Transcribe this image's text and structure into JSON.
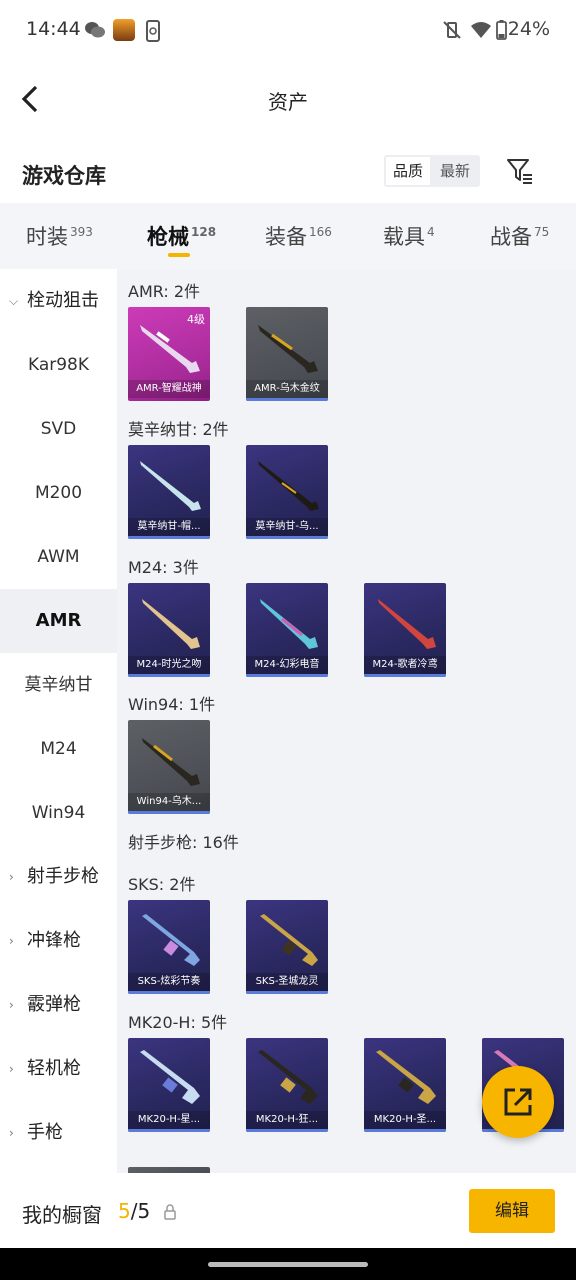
{
  "status_bar": {
    "time": "14:44",
    "battery": "24%"
  },
  "header": {
    "title": "资产",
    "section_title": "游戏仓库",
    "sort_quality": "品质",
    "sort_newest": "最新"
  },
  "tabs": [
    {
      "label": "时装",
      "count": "393"
    },
    {
      "label": "枪械",
      "count": "128"
    },
    {
      "label": "装备",
      "count": "166"
    },
    {
      "label": "载具",
      "count": "4"
    },
    {
      "label": "战备",
      "count": "75"
    }
  ],
  "sidebar": [
    {
      "label": "栓动狙击"
    },
    {
      "label": "Kar98K"
    },
    {
      "label": "SVD"
    },
    {
      "label": "M200"
    },
    {
      "label": "AWM"
    },
    {
      "label": "AMR"
    },
    {
      "label": "莫辛纳甘"
    },
    {
      "label": "M24"
    },
    {
      "label": "Win94"
    },
    {
      "label": "射手步枪"
    },
    {
      "label": "冲锋枪"
    },
    {
      "label": "霰弹枪"
    },
    {
      "label": "轻机枪"
    },
    {
      "label": "手枪"
    }
  ],
  "groups": [
    {
      "heading": "AMR: 2件",
      "items": [
        {
          "label": "AMR-智耀战神",
          "level": "4级"
        },
        {
          "label": "AMR-乌木金纹"
        }
      ]
    },
    {
      "heading": "莫辛纳甘: 2件",
      "items": [
        {
          "label": "莫辛纳甘-帽..."
        },
        {
          "label": "莫辛纳甘-乌..."
        }
      ]
    },
    {
      "heading": "M24: 3件",
      "items": [
        {
          "label": "M24-时光之吻"
        },
        {
          "label": "M24-幻彩电音"
        },
        {
          "label": "M24-歌者冷鸢"
        }
      ]
    },
    {
      "heading": "Win94: 1件",
      "items": [
        {
          "label": "Win94-乌木..."
        }
      ]
    },
    {
      "heading": "射手步枪: 16件"
    },
    {
      "heading": "SKS: 2件",
      "items": [
        {
          "label": "SKS-炫彩节奏"
        },
        {
          "label": "SKS-圣城龙灵"
        }
      ]
    },
    {
      "heading": "MK20-H: 5件",
      "items": [
        {
          "label": "MK20-H-星..."
        },
        {
          "label": "MK20-H-狂..."
        },
        {
          "label": "MK20-H-圣..."
        }
      ]
    }
  ],
  "bottom_bar": {
    "label": "我的橱窗",
    "count_current": "5",
    "count_total": "/5",
    "edit_label": "编辑"
  },
  "colors": {
    "accent": "#f7b500",
    "legendary": "#c63bb5",
    "epic": "#3a3768",
    "common": "#55595e"
  },
  "icons": [
    "back-arrow-icon",
    "filter-icon",
    "lock-icon",
    "share-external-icon",
    "chevron-down-icon",
    "chevron-right-icon",
    "wechat-icon",
    "wifi-icon",
    "battery-icon",
    "mute-icon"
  ]
}
